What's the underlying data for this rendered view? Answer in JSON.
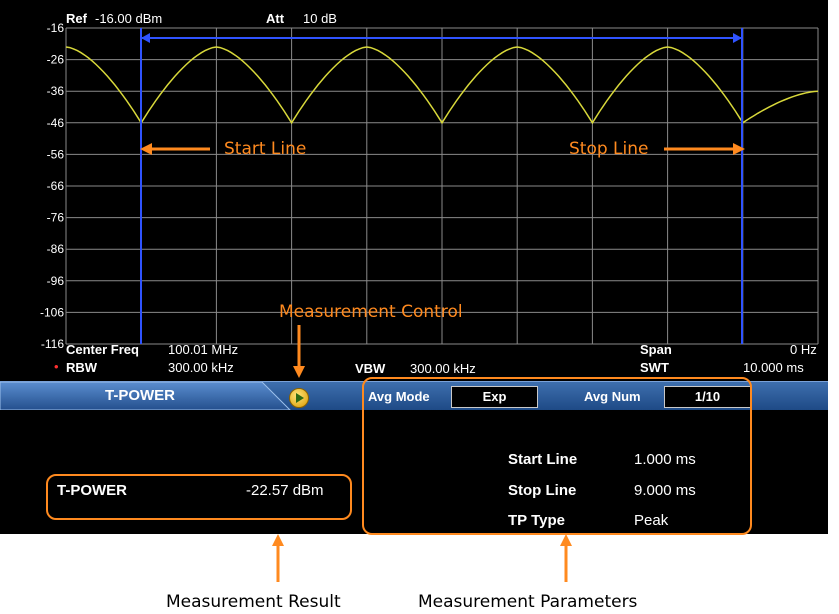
{
  "header": {
    "ref_label": "Ref",
    "ref_value": "-16.00 dBm",
    "att_label": "Att",
    "att_value": "10 dB"
  },
  "chart_data": {
    "type": "line",
    "y_ticks": [
      "-16",
      "-26",
      "-36",
      "-46",
      "-56",
      "-66",
      "-76",
      "-86",
      "-96",
      "-106",
      "-116"
    ],
    "ylim": [
      -116,
      -16
    ],
    "grid": true,
    "series": [
      {
        "values": [
          -22,
          -46,
          -22,
          -46,
          -22,
          -46,
          -22,
          -46,
          -22,
          -46,
          -36
        ]
      }
    ]
  },
  "footer": {
    "center_freq_label": "Center Freq",
    "center_freq_value": "100.01 MHz",
    "span_label": "Span",
    "span_value": "0 Hz",
    "rbw_marker": "•",
    "rbw_label": "RBW",
    "rbw_value": "300.00 kHz",
    "vbw_label": "VBW",
    "vbw_value": "300.00 kHz",
    "swt_label": "SWT",
    "swt_value": "10.000 ms"
  },
  "tabbar": {
    "tab_label": "T-POWER",
    "avg_mode_label": "Avg Mode",
    "avg_mode_value": "Exp",
    "avg_num_label": "Avg Num",
    "avg_num_value": "1/10"
  },
  "params": {
    "start_line_label": "Start Line",
    "start_line_value": "1.000 ms",
    "stop_line_label": "Stop Line",
    "stop_line_value": "9.000 ms",
    "tp_type_label": "TP Type",
    "tp_type_value": "Peak"
  },
  "result": {
    "label": "T-POWER",
    "value": "-22.57 dBm"
  },
  "annotations": {
    "start_line": "Start Line",
    "stop_line": "Stop Line",
    "measurement_control": "Measurement Control",
    "measurement_result": "Measurement Result",
    "measurement_parameters": "Measurement Parameters"
  },
  "colors": {
    "trace": "#d8d83a",
    "lines": "#2f53ff",
    "annotation": "#ff8a1f",
    "tab_bar": "#2a5a9a"
  }
}
